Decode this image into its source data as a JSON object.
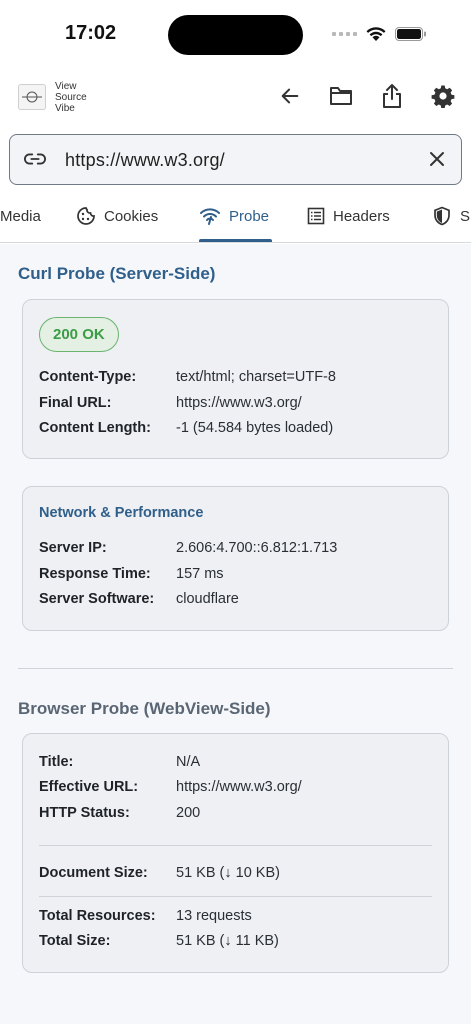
{
  "status": {
    "time": "17:02"
  },
  "app": {
    "title_lines": [
      "View",
      "Source",
      "Vibe"
    ]
  },
  "url": {
    "value": "https://www.w3.org/"
  },
  "tabs": [
    {
      "label": "Media",
      "icon": "media-icon"
    },
    {
      "label": "Cookies",
      "icon": "cookie-icon"
    },
    {
      "label": "Probe",
      "icon": "wifi-probe-icon",
      "active": true
    },
    {
      "label": "Headers",
      "icon": "list-icon"
    },
    {
      "label": "S",
      "icon": "shield-icon"
    }
  ],
  "curl": {
    "title": "Curl Probe (Server-Side)",
    "status_badge": "200 OK",
    "rows": [
      {
        "key": "Content-Type:",
        "value": "text/html; charset=UTF-8"
      },
      {
        "key": "Final URL:",
        "value": "https://www.w3.org/"
      },
      {
        "key": "Content Length:",
        "value": "-1 (54.584 bytes loaded)"
      }
    ],
    "network": {
      "title": "Network & Performance",
      "rows": [
        {
          "key": "Server IP:",
          "value": "2.606:4.700::6.812:1.713"
        },
        {
          "key": "Response Time:",
          "value": "157 ms"
        },
        {
          "key": "Server Software:",
          "value": "cloudflare"
        }
      ]
    }
  },
  "browser": {
    "title": "Browser Probe (WebView-Side)",
    "rows": [
      {
        "key": "Title:",
        "value": "N/A"
      },
      {
        "key": "Effective URL:",
        "value": "https://www.w3.org/"
      },
      {
        "key": "HTTP Status:",
        "value": "200"
      }
    ],
    "document": {
      "key": "Document Size:",
      "value": "51 KB (↓ 10 KB)"
    },
    "totals": [
      {
        "key": "Total Resources:",
        "value": "13 requests"
      },
      {
        "key": "Total Size:",
        "value": "51 KB (↓ 11 KB)"
      }
    ]
  },
  "colors": {
    "accent": "#2f5f8a",
    "success": "#3c9c45"
  }
}
